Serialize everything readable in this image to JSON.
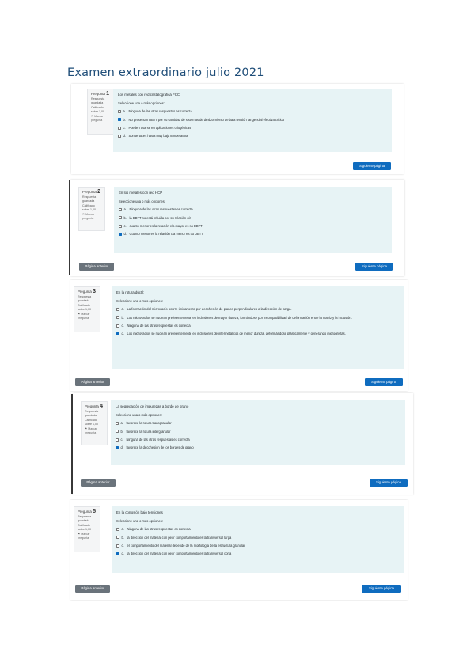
{
  "title": "Examen extraordinario julio 2021",
  "labels": {
    "question": "Pregunta",
    "state": "Respuesta guardada",
    "grade": "Calificado sobre 1,00",
    "flag": "Marcar pregunta",
    "prompt": "Seleccione una o más opciones:",
    "next": "Siguiente página",
    "prev": "Página anterior"
  },
  "questions": [
    {
      "number": "1",
      "text": "Los metales con red cristalográfica FCC:",
      "options": [
        {
          "letter": "a.",
          "text": "Ninguna de las otras respuestas es correcta",
          "checked": false
        },
        {
          "letter": "b.",
          "text": "No presentan DBTT por su cantidad de sistemas de deslizamiento de baja tensión tangencial efectiva crítica",
          "checked": true
        },
        {
          "letter": "c.",
          "text": "Pueden usarse en aplicaciones criogénicas",
          "checked": false
        },
        {
          "letter": "d.",
          "text": "Son tenaces hasta muy baja temperatura",
          "checked": false
        }
      ]
    },
    {
      "number": "2",
      "text": "En los metales con red HCP",
      "options": [
        {
          "letter": "a.",
          "text": "Ninguna de las otras respuestas es correcta",
          "checked": false
        },
        {
          "letter": "b.",
          "text": "la DBTT no está influida por su relación c/a",
          "checked": false
        },
        {
          "letter": "c.",
          "text": "cuanto menor es la relación c/a mayor es su DBTT",
          "checked": false
        },
        {
          "letter": "d.",
          "text": "Cuanto menor es la relación c/a menor es su DBTT",
          "checked": true
        }
      ]
    },
    {
      "number": "3",
      "text": "En la rotura dúctil:",
      "options": [
        {
          "letter": "a.",
          "text": "La formación del microvacío ocurre únicamente por decohesión de planos perpendiculares a la dirección de carga.",
          "checked": false
        },
        {
          "letter": "b.",
          "text": "Los microvacíos se nuclean preferentemente en inclusiones de mayor dureza, formándose por incompatibilidad de deformación entre la matriz y la inclusión.",
          "checked": false
        },
        {
          "letter": "c.",
          "text": "Ninguna de las otras respuestas es correcta",
          "checked": false
        },
        {
          "letter": "d.",
          "text": "Los microvacíos se nuclean preferentemente en inclusiones de intermetálicos de menor dureza, deformándose plásticamente y generando microgrietas.",
          "checked": true
        }
      ]
    },
    {
      "number": "4",
      "text": "La segregación de impurezas a borde de grano",
      "options": [
        {
          "letter": "a.",
          "text": "favorece la rotura transgranular",
          "checked": false
        },
        {
          "letter": "b.",
          "text": "favorece la rotura intergranular",
          "checked": false
        },
        {
          "letter": "c.",
          "text": "Ninguna de las otras respuestas es correcta",
          "checked": false
        },
        {
          "letter": "d.",
          "text": "favorece la decohesión de los bordes de grano",
          "checked": true
        }
      ]
    },
    {
      "number": "5",
      "text": "En la corrosión bajo tensiones",
      "options": [
        {
          "letter": "a.",
          "text": "Ninguna de las otras respuestas es correcta",
          "checked": false
        },
        {
          "letter": "b.",
          "text": "la dirección del material con peor comportamiento es la transversal larga",
          "checked": false
        },
        {
          "letter": "c.",
          "text": "el comportamiento del material depende de la morfología de la estructura granular",
          "checked": false
        },
        {
          "letter": "d.",
          "text": "la dirección del material con peor comportamiento es la transversal corta",
          "checked": true
        }
      ]
    }
  ]
}
